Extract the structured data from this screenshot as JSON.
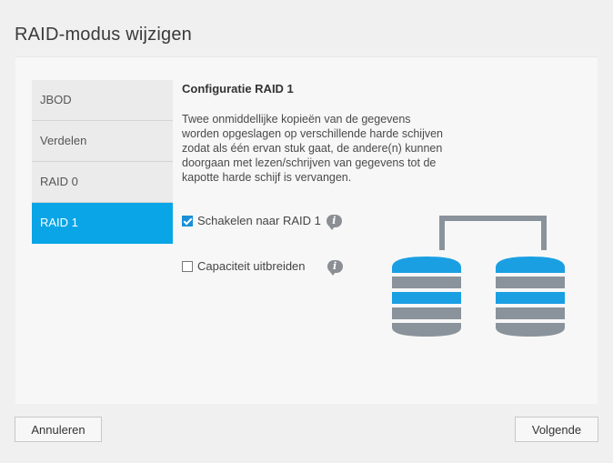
{
  "window": {
    "title": "RAID-modus wijzigen"
  },
  "sidebar": {
    "items": [
      {
        "label": "JBOD"
      },
      {
        "label": "Verdelen"
      },
      {
        "label": "RAID 0"
      },
      {
        "label": "RAID 1",
        "active": true
      }
    ]
  },
  "main": {
    "heading": "Configuratie RAID 1",
    "description": "Twee onmiddellijke kopieën van de gegevens worden opgeslagen op verschillende harde schijven zodat als één ervan stuk gaat, de andere(n) kunnen doorgaan met lezen/schrijven van gegevens tot de kapotte harde schijf is vervangen.",
    "options": [
      {
        "label": "Schakelen naar RAID 1",
        "checked": true
      },
      {
        "label": "Capaciteit uitbreiden",
        "checked": false
      }
    ],
    "info_icon": "i"
  },
  "footer": {
    "cancel_label": "Annuleren",
    "next_label": "Volgende"
  },
  "colors": {
    "accent": "#0aa5e6",
    "disk_blue": "#1a9fe3",
    "disk_gray": "#8a939b"
  },
  "icons": [
    "checkbox-checked-icon",
    "checkbox-empty-icon",
    "info-icon",
    "raid1-mirror-diagram"
  ]
}
